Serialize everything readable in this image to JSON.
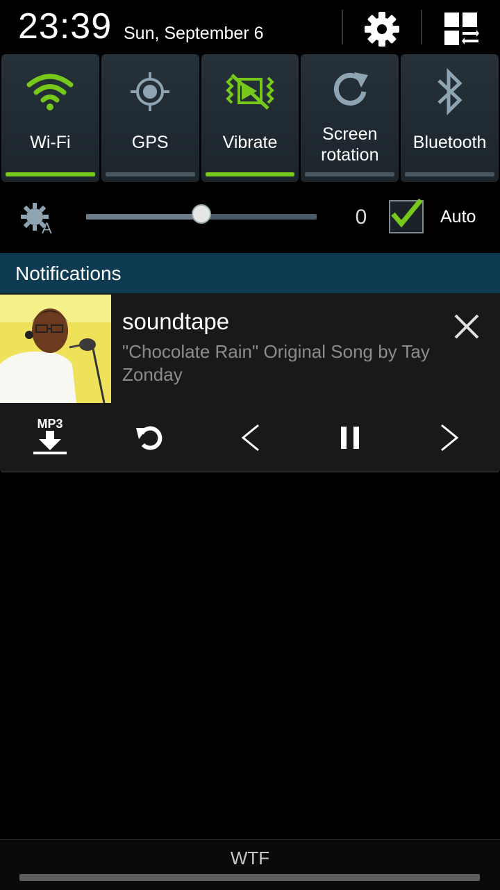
{
  "status_bar": {
    "time": "23:39",
    "date": "Sun, September 6",
    "icons": [
      "settings-gear-icon",
      "toggle-grid-icon"
    ]
  },
  "quick_toggles": [
    {
      "label": "Wi-Fi",
      "icon": "wifi-icon",
      "on": true
    },
    {
      "label": "GPS",
      "icon": "gps-icon",
      "on": false
    },
    {
      "label": "Vibrate",
      "icon": "vibrate-icon",
      "on": true
    },
    {
      "label_line1": "Screen",
      "label_line2": "rotation",
      "icon": "rotation-icon",
      "on": false
    },
    {
      "label": "Bluetooth",
      "icon": "bluetooth-icon",
      "on": false
    }
  ],
  "brightness": {
    "icon": "auto-brightness-icon",
    "value": "0",
    "level": 0.5,
    "auto_checked": true,
    "auto_label": "Auto"
  },
  "notifications": {
    "header": "Notifications",
    "items": [
      {
        "app": "soundtape",
        "title": "\"Chocolate Rain\" Original Song by Tay Zonday",
        "controls": [
          "mp3-download-icon",
          "repeat-icon",
          "previous-icon",
          "pause-icon",
          "next-icon"
        ],
        "mp3_label": "MP3"
      }
    ]
  },
  "footer": {
    "carrier": "WTF"
  },
  "colors": {
    "toggle_on": "#76c81b",
    "toggle_off": "#4b5860",
    "header_bg": "#0f3b52",
    "icon_off": "#8fa4b2"
  }
}
